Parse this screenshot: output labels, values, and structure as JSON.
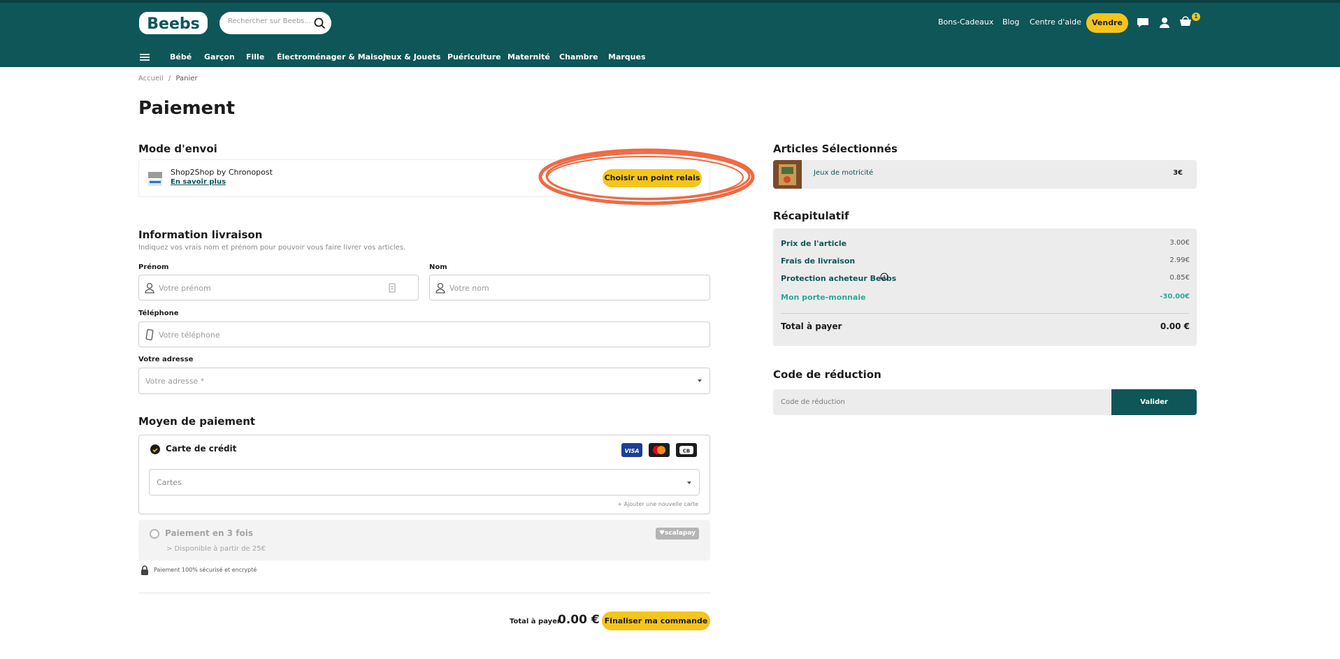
{
  "colors": {
    "brand": "#0e5658",
    "accent": "#f5c51c",
    "highlight": "#f06a43",
    "positive": "#2aa99b"
  },
  "header": {
    "logo_text": "Beebs",
    "search_placeholder": "Rechercher sur Beebs...",
    "links": [
      "Bons-Cadeaux",
      "Blog",
      "Centre d'aide"
    ],
    "sell_label": "Vendre",
    "cart_count": "1",
    "icons": [
      "chat-icon",
      "user-icon",
      "cart-icon"
    ]
  },
  "nav": {
    "items": [
      "Bébé",
      "Garçon",
      "Fille",
      "Électroménager & Maison",
      "Jeux & Jouets",
      "Puériculture",
      "Maternité",
      "Chambre",
      "Marques"
    ]
  },
  "breadcrumb": {
    "home": "Accueil",
    "separator": "/",
    "current": "Panier"
  },
  "page_title": "Paiement",
  "shipping": {
    "title": "Mode d'envoi",
    "carrier": "Shop2Shop by Chronopost",
    "more_link": "En savoir plus",
    "relay_button": "Choisir un point relais"
  },
  "delivery": {
    "title": "Information livraison",
    "subtitle": "Indiquez vos vrais nom et prénom pour pouvoir vous faire livrer vos articles.",
    "first_name_label": "Prénom",
    "first_name_placeholder": "Votre prénom",
    "last_name_label": "Nom",
    "last_name_placeholder": "Votre nom",
    "phone_label": "Téléphone",
    "phone_placeholder": "Votre téléphone",
    "address_label": "Votre adresse",
    "address_placeholder": "Votre adresse *"
  },
  "payment": {
    "title": "Moyen de paiement",
    "credit_card_label": "Carte de crédit",
    "card_logos": [
      "VISA",
      "mastercard",
      "CB"
    ],
    "cards_placeholder": "Cartes",
    "add_card_link": "+ Ajouter une nouvelle carte",
    "installments_label": "Paiement en 3 fois",
    "installments_sub": "> Disponible à partir de 25€",
    "installments_brand": "♥scalapay",
    "secure_text": "Paiement 100% sécurisé et encrypté"
  },
  "footer_total": {
    "label": "Total à payer",
    "value": "0.00 €",
    "button": "Finaliser ma commande"
  },
  "articles": {
    "title": "Articles Sélectionnés",
    "items": [
      {
        "name": "Jeux de motricité",
        "price": "3€"
      }
    ]
  },
  "recap": {
    "title": "Récapitulatif",
    "rows": [
      {
        "label": "Prix de l'article",
        "value": "3.00€"
      },
      {
        "label": "Frais de livraison",
        "value": "2.99€"
      },
      {
        "label": "Protection acheteur Beebs",
        "value": "0.85€"
      },
      {
        "label": "Mon porte-monnaie",
        "value": "-30.00€"
      }
    ],
    "total_label": "Total à payer",
    "total_value": "0.00 €"
  },
  "promo": {
    "title": "Code de réduction",
    "placeholder": "Code de réduction",
    "button": "Valider"
  }
}
